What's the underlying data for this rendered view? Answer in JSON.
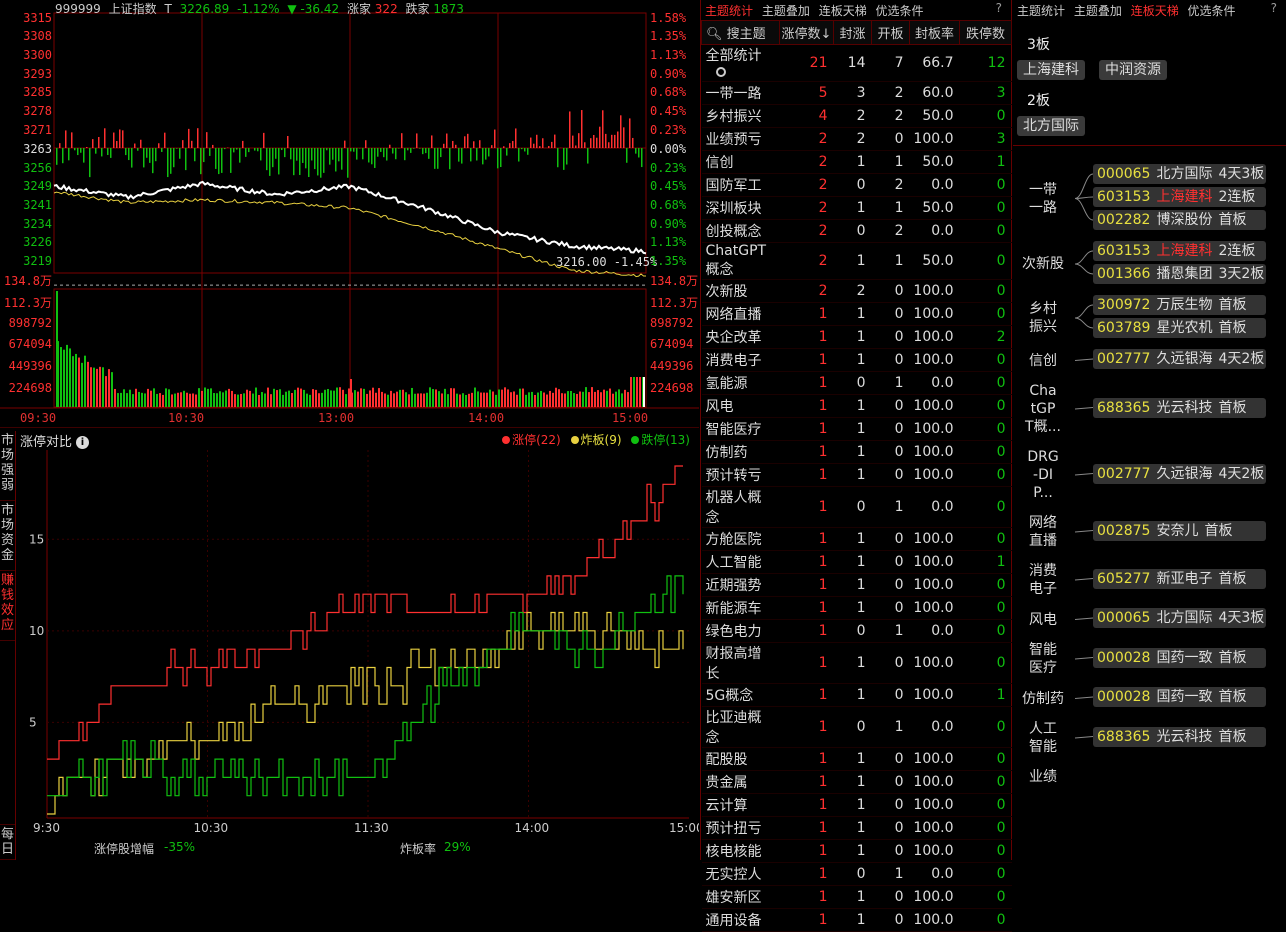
{
  "index_header": {
    "code": "999999",
    "name": "上证指数",
    "marker": "T",
    "price": "3226.89",
    "pct": "-1.12%",
    "change": "▼ -36.42",
    "up_label": "涨家",
    "up_count": "322",
    "down_label": "跌家",
    "down_count": "1873"
  },
  "price_axis": {
    "left": [
      "3315",
      "3308",
      "3300",
      "3293",
      "3285",
      "3278",
      "3271",
      "3263",
      "3256",
      "3249",
      "3241",
      "3234",
      "3226",
      "3219"
    ],
    "right": [
      "1.58%",
      "1.35%",
      "1.13%",
      "0.90%",
      "0.68%",
      "0.45%",
      "0.23%",
      "0.00%",
      "0.23%",
      "0.45%",
      "0.68%",
      "0.90%",
      "1.13%",
      "1.35%"
    ]
  },
  "volume_axis": {
    "left": [
      "134.8万",
      "112.3万",
      "898792",
      "674094",
      "449396",
      "224698"
    ],
    "right": [
      "134.8万",
      "112.3万",
      "898792",
      "674094",
      "449396",
      "224698"
    ]
  },
  "time_axis": [
    "09:30",
    "10:30",
    "13:00",
    "14:00",
    "15:00"
  ],
  "price_annotation": "3216.00  -1.45%",
  "colors": {
    "up": "#ff3030",
    "down": "#10c010",
    "price": "#ffffff",
    "avg": "#e8d040",
    "grid": "#7a0000",
    "bomb": "#e8c040"
  },
  "chart_data": [
    {
      "type": "line",
      "title": "上证指数",
      "x": [
        "09:30",
        "10:00",
        "10:30",
        "11:00",
        "11:30",
        "13:30",
        "14:00",
        "14:30",
        "15:00"
      ],
      "series": [
        {
          "values": [
            3251,
            3247,
            3252,
            3248,
            3251,
            3243,
            3234,
            3229,
            3227
          ]
        },
        {
          "values": [
            3249,
            3245,
            3246,
            3245,
            3243,
            3236,
            3228,
            3220,
            3218
          ]
        }
      ],
      "ylim": [
        3219,
        3315
      ]
    },
    {
      "type": "line",
      "title": "涨停对比",
      "x": [
        "9:30",
        "10:00",
        "10:30",
        "11:00",
        "11:30",
        "13:30",
        "14:00",
        "14:30",
        "15:00"
      ],
      "series": [
        {
          "name": "涨停",
          "values": [
            3,
            7,
            8,
            9,
            12,
            11,
            12,
            14,
            19
          ]
        },
        {
          "name": "炸板",
          "values": [
            1,
            3,
            4,
            6,
            7,
            8,
            10,
            10,
            9
          ]
        },
        {
          "name": "跌停",
          "values": [
            1,
            3,
            2,
            2,
            2,
            7,
            10,
            9,
            13
          ]
        }
      ],
      "yticks": [
        5,
        10,
        15
      ],
      "ylim": [
        0,
        19
      ]
    }
  ],
  "compare": {
    "title": "涨停对比",
    "legend": [
      {
        "label": "涨停(22)",
        "color": "#ff3030"
      },
      {
        "label": "炸板(9)",
        "color": "#e8d040"
      },
      {
        "label": "跌停(13)",
        "color": "#10c010"
      }
    ],
    "yticks": [
      "15",
      "10",
      "5"
    ],
    "xticks": [
      "9:30",
      "10:30",
      "11:30",
      "14:00",
      "15:00"
    ],
    "foot_label1": "涨停股增幅",
    "foot_value1": "-35%",
    "foot_label2": "炸板率",
    "foot_value2": "29%"
  },
  "vtabs": [
    {
      "label": "市场强弱"
    },
    {
      "label": "市场资金"
    },
    {
      "label": "赚钱效应"
    },
    {
      "label": "每日"
    }
  ],
  "mid_tabs": [
    "主题统计",
    "主题叠加",
    "连板天梯",
    "优选条件"
  ],
  "theme_table": {
    "search_label": "搜主题",
    "columns": [
      "涨停数↓",
      "封涨",
      "开板",
      "封板率",
      "跌停数"
    ],
    "total": {
      "name": "全部统计",
      "limit_up": "21",
      "sealed": "14",
      "opened": "7",
      "rate": "66.7",
      "limit_down": "12"
    },
    "rows": [
      {
        "name": "一带一路",
        "limit_up": "5",
        "sealed": "3",
        "opened": "2",
        "rate": "60.0",
        "limit_down": "3"
      },
      {
        "name": "乡村振兴",
        "limit_up": "4",
        "sealed": "2",
        "opened": "2",
        "rate": "50.0",
        "limit_down": "0"
      },
      {
        "name": "业绩预亏",
        "limit_up": "2",
        "sealed": "2",
        "opened": "0",
        "rate": "100.0",
        "limit_down": "3"
      },
      {
        "name": "信创",
        "limit_up": "2",
        "sealed": "1",
        "opened": "1",
        "rate": "50.0",
        "limit_down": "1"
      },
      {
        "name": "国防军工",
        "limit_up": "2",
        "sealed": "0",
        "opened": "2",
        "rate": "0.0",
        "limit_down": "0"
      },
      {
        "name": "深圳板块",
        "limit_up": "2",
        "sealed": "1",
        "opened": "1",
        "rate": "50.0",
        "limit_down": "0"
      },
      {
        "name": "创投概念",
        "limit_up": "2",
        "sealed": "0",
        "opened": "2",
        "rate": "0.0",
        "limit_down": "0"
      },
      {
        "name": "ChatGPT概念",
        "limit_up": "2",
        "sealed": "1",
        "opened": "1",
        "rate": "50.0",
        "limit_down": "0"
      },
      {
        "name": "次新股",
        "limit_up": "2",
        "sealed": "2",
        "opened": "0",
        "rate": "100.0",
        "limit_down": "0"
      },
      {
        "name": "网络直播",
        "limit_up": "1",
        "sealed": "1",
        "opened": "0",
        "rate": "100.0",
        "limit_down": "0"
      },
      {
        "name": "央企改革",
        "limit_up": "1",
        "sealed": "1",
        "opened": "0",
        "rate": "100.0",
        "limit_down": "2"
      },
      {
        "name": "消费电子",
        "limit_up": "1",
        "sealed": "1",
        "opened": "0",
        "rate": "100.0",
        "limit_down": "0"
      },
      {
        "name": "氢能源",
        "limit_up": "1",
        "sealed": "0",
        "opened": "1",
        "rate": "0.0",
        "limit_down": "0"
      },
      {
        "name": "风电",
        "limit_up": "1",
        "sealed": "1",
        "opened": "0",
        "rate": "100.0",
        "limit_down": "0"
      },
      {
        "name": "智能医疗",
        "limit_up": "1",
        "sealed": "1",
        "opened": "0",
        "rate": "100.0",
        "limit_down": "0"
      },
      {
        "name": "仿制药",
        "limit_up": "1",
        "sealed": "1",
        "opened": "0",
        "rate": "100.0",
        "limit_down": "0"
      },
      {
        "name": "预计转亏",
        "limit_up": "1",
        "sealed": "1",
        "opened": "0",
        "rate": "100.0",
        "limit_down": "0"
      },
      {
        "name": "机器人概念",
        "limit_up": "1",
        "sealed": "0",
        "opened": "1",
        "rate": "0.0",
        "limit_down": "0"
      },
      {
        "name": "方舱医院",
        "limit_up": "1",
        "sealed": "1",
        "opened": "0",
        "rate": "100.0",
        "limit_down": "0"
      },
      {
        "name": "人工智能",
        "limit_up": "1",
        "sealed": "1",
        "opened": "0",
        "rate": "100.0",
        "limit_down": "1"
      },
      {
        "name": "近期强势",
        "limit_up": "1",
        "sealed": "1",
        "opened": "0",
        "rate": "100.0",
        "limit_down": "0"
      },
      {
        "name": "新能源车",
        "limit_up": "1",
        "sealed": "1",
        "opened": "0",
        "rate": "100.0",
        "limit_down": "0"
      },
      {
        "name": "绿色电力",
        "limit_up": "1",
        "sealed": "0",
        "opened": "1",
        "rate": "0.0",
        "limit_down": "0"
      },
      {
        "name": "财报高增长",
        "limit_up": "1",
        "sealed": "1",
        "opened": "0",
        "rate": "100.0",
        "limit_down": "0"
      },
      {
        "name": "5G概念",
        "limit_up": "1",
        "sealed": "1",
        "opened": "0",
        "rate": "100.0",
        "limit_down": "1"
      },
      {
        "name": "比亚迪概念",
        "limit_up": "1",
        "sealed": "0",
        "opened": "1",
        "rate": "0.0",
        "limit_down": "0"
      },
      {
        "name": "配股股",
        "limit_up": "1",
        "sealed": "1",
        "opened": "0",
        "rate": "100.0",
        "limit_down": "0"
      },
      {
        "name": "贵金属",
        "limit_up": "1",
        "sealed": "1",
        "opened": "0",
        "rate": "100.0",
        "limit_down": "0"
      },
      {
        "name": "云计算",
        "limit_up": "1",
        "sealed": "1",
        "opened": "0",
        "rate": "100.0",
        "limit_down": "0"
      },
      {
        "name": "预计扭亏",
        "limit_up": "1",
        "sealed": "1",
        "opened": "0",
        "rate": "100.0",
        "limit_down": "0"
      },
      {
        "name": "核电核能",
        "limit_up": "1",
        "sealed": "1",
        "opened": "0",
        "rate": "100.0",
        "limit_down": "0"
      },
      {
        "name": "无实控人",
        "limit_up": "1",
        "sealed": "0",
        "opened": "1",
        "rate": "0.0",
        "limit_down": "0"
      },
      {
        "name": "雄安新区",
        "limit_up": "1",
        "sealed": "1",
        "opened": "0",
        "rate": "100.0",
        "limit_down": "0"
      },
      {
        "name": "通用设备",
        "limit_up": "1",
        "sealed": "1",
        "opened": "0",
        "rate": "100.0",
        "limit_down": "0"
      }
    ]
  },
  "right_tabs": [
    "主题统计",
    "主题叠加",
    "连板天梯",
    "优选条件"
  ],
  "boards": [
    {
      "label": "3板",
      "chips": [
        "上海建科",
        "中润资源"
      ]
    },
    {
      "label": "2板",
      "chips": [
        "北方国际"
      ]
    }
  ],
  "ladder": [
    {
      "theme": "一带\n一路",
      "stocks": [
        {
          "code": "000065",
          "name": "北方国际",
          "status": "4天3板",
          "hl": false
        },
        {
          "code": "603153",
          "name": "上海建科",
          "status": "2连板",
          "hl": true
        },
        {
          "code": "002282",
          "name": "博深股份",
          "status": "首板",
          "hl": false
        }
      ]
    },
    {
      "theme": "次新股",
      "stocks": [
        {
          "code": "603153",
          "name": "上海建科",
          "status": "2连板",
          "hl": true
        },
        {
          "code": "001366",
          "name": "播恩集团",
          "status": "3天2板",
          "hl": false
        }
      ]
    },
    {
      "theme": "乡村\n振兴",
      "stocks": [
        {
          "code": "300972",
          "name": "万辰生物",
          "status": "首板",
          "hl": false
        },
        {
          "code": "603789",
          "name": "星光农机",
          "status": "首板",
          "hl": false
        }
      ]
    },
    {
      "theme": "信创",
      "stocks": [
        {
          "code": "002777",
          "name": "久远银海",
          "status": "4天2板",
          "hl": false
        }
      ]
    },
    {
      "theme": "Cha\ntGP\nT概...",
      "stocks": [
        {
          "code": "688365",
          "name": "光云科技",
          "status": "首板",
          "hl": false
        }
      ]
    },
    {
      "theme": "DRG\n-DI\nP...",
      "stocks": [
        {
          "code": "002777",
          "name": "久远银海",
          "status": "4天2板",
          "hl": false
        }
      ]
    },
    {
      "theme": "网络\n直播",
      "stocks": [
        {
          "code": "002875",
          "name": "安奈儿",
          "status": "首板",
          "hl": false
        }
      ]
    },
    {
      "theme": "消费\n电子",
      "stocks": [
        {
          "code": "605277",
          "name": "新亚电子",
          "status": "首板",
          "hl": false
        }
      ]
    },
    {
      "theme": "风电",
      "stocks": [
        {
          "code": "000065",
          "name": "北方国际",
          "status": "4天3板",
          "hl": false
        }
      ]
    },
    {
      "theme": "智能\n医疗",
      "stocks": [
        {
          "code": "000028",
          "name": "国药一致",
          "status": "首板",
          "hl": false
        }
      ]
    },
    {
      "theme": "仿制药",
      "stocks": [
        {
          "code": "000028",
          "name": "国药一致",
          "status": "首板",
          "hl": false
        }
      ]
    },
    {
      "theme": "人工\n智能",
      "stocks": [
        {
          "code": "688365",
          "name": "光云科技",
          "status": "首板",
          "hl": false
        }
      ]
    },
    {
      "theme": "业绩",
      "stocks": []
    }
  ]
}
